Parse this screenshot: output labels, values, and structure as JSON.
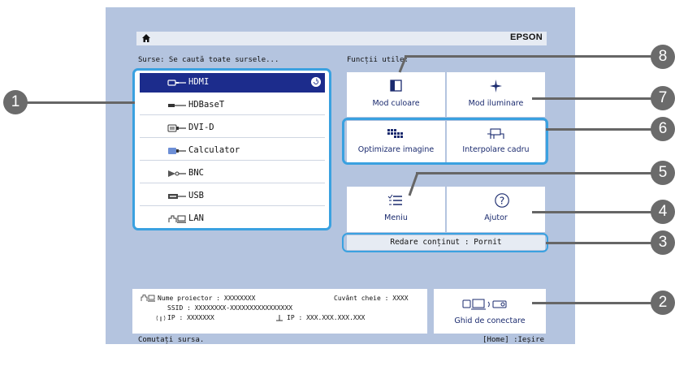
{
  "header": {
    "brand": "EPSON"
  },
  "sources": {
    "heading": "Surse: Se caută toate sursele...",
    "items": [
      {
        "label": "HDMI",
        "icon": "hdmi-icon"
      },
      {
        "label": "HDBaseT",
        "icon": "hdbaset-icon"
      },
      {
        "label": "DVI-D",
        "icon": "dvi-icon"
      },
      {
        "label": "Calculator",
        "icon": "computer-icon"
      },
      {
        "label": "BNC",
        "icon": "bnc-icon"
      },
      {
        "label": "USB",
        "icon": "usb-icon"
      },
      {
        "label": "LAN",
        "icon": "lan-icon"
      }
    ]
  },
  "functions": {
    "heading": "Funcții utile:",
    "color_mode": "Mod culoare",
    "light_mode": "Mod iluminare",
    "image_opt": "Optimizare imagine",
    "frame_interp": "Interpolare cadru",
    "menu": "Meniu",
    "help": "Ajutor"
  },
  "status": {
    "content_playback": "Redare conținut : Pornit"
  },
  "info": {
    "projector_name": "Nume proiector : XXXXXXXX",
    "keyword": "Cuvânt cheie : XXXX",
    "ssid": "SSID : XXXXXXXX-XXXXXXXXXXXXXXXX",
    "ip_wireless": "IP : XXXXXXX",
    "ip_wired": "IP : XXX.XXX.XXX.XXX"
  },
  "guide": {
    "label": "Ghid de conectare"
  },
  "footer": {
    "left": "Comutați sursa.",
    "right": "[Home] :Ieșire"
  },
  "callouts": [
    "1",
    "2",
    "3",
    "4",
    "5",
    "6",
    "7",
    "8"
  ],
  "colors": {
    "panel_bg": "#b4c4df",
    "highlight": "#3aa1e0",
    "selected": "#1c2c8c",
    "callout": "#6b6b6b"
  }
}
